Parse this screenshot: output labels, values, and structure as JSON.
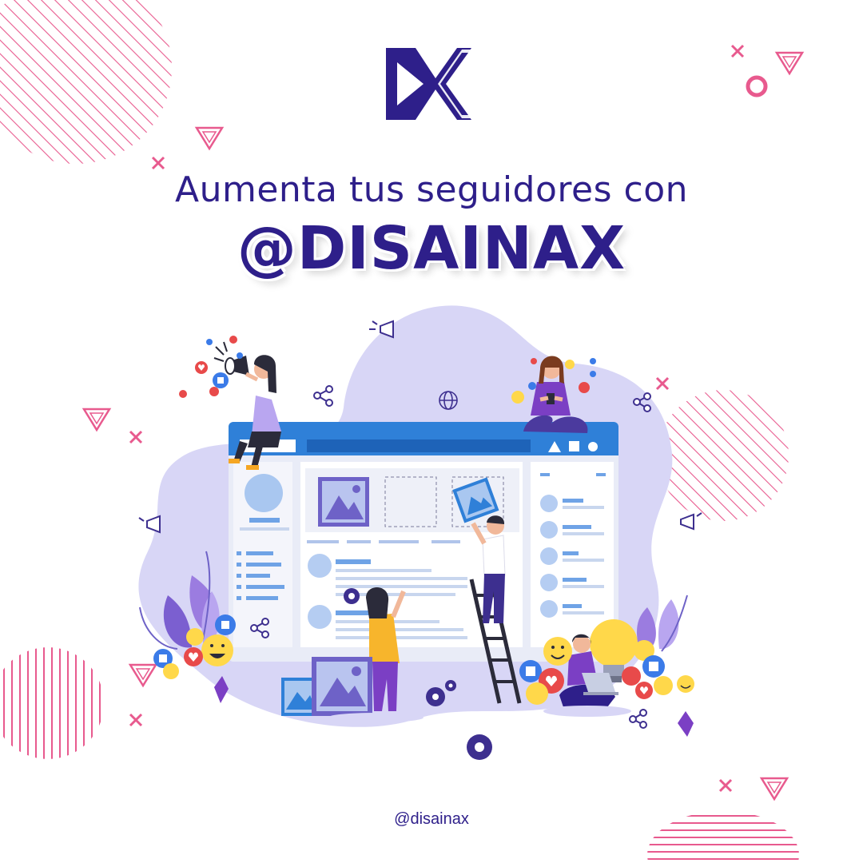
{
  "headline": "Aumenta tus seguidores con",
  "brand": "@DISAINAX",
  "footer": {
    "handle": "@disainax"
  },
  "colors": {
    "brand_navy": "#2e1f8a",
    "accent_pink": "#e85a8e",
    "lavender": "#d5d3f5",
    "browser_blue": "#3d8fe0",
    "emoji_yellow": "#ffd84a",
    "like_blue": "#3b7be8",
    "heart_red": "#e84a4a",
    "shirt_purple": "#7b3fc4"
  },
  "icons": [
    "disainax-logo-icon",
    "megaphone-icon",
    "share-icon",
    "globe-icon",
    "heart-icon",
    "like-icon",
    "smiley-icon",
    "gear-icon",
    "lightbulb-icon",
    "image-icon",
    "laptop-icon"
  ]
}
